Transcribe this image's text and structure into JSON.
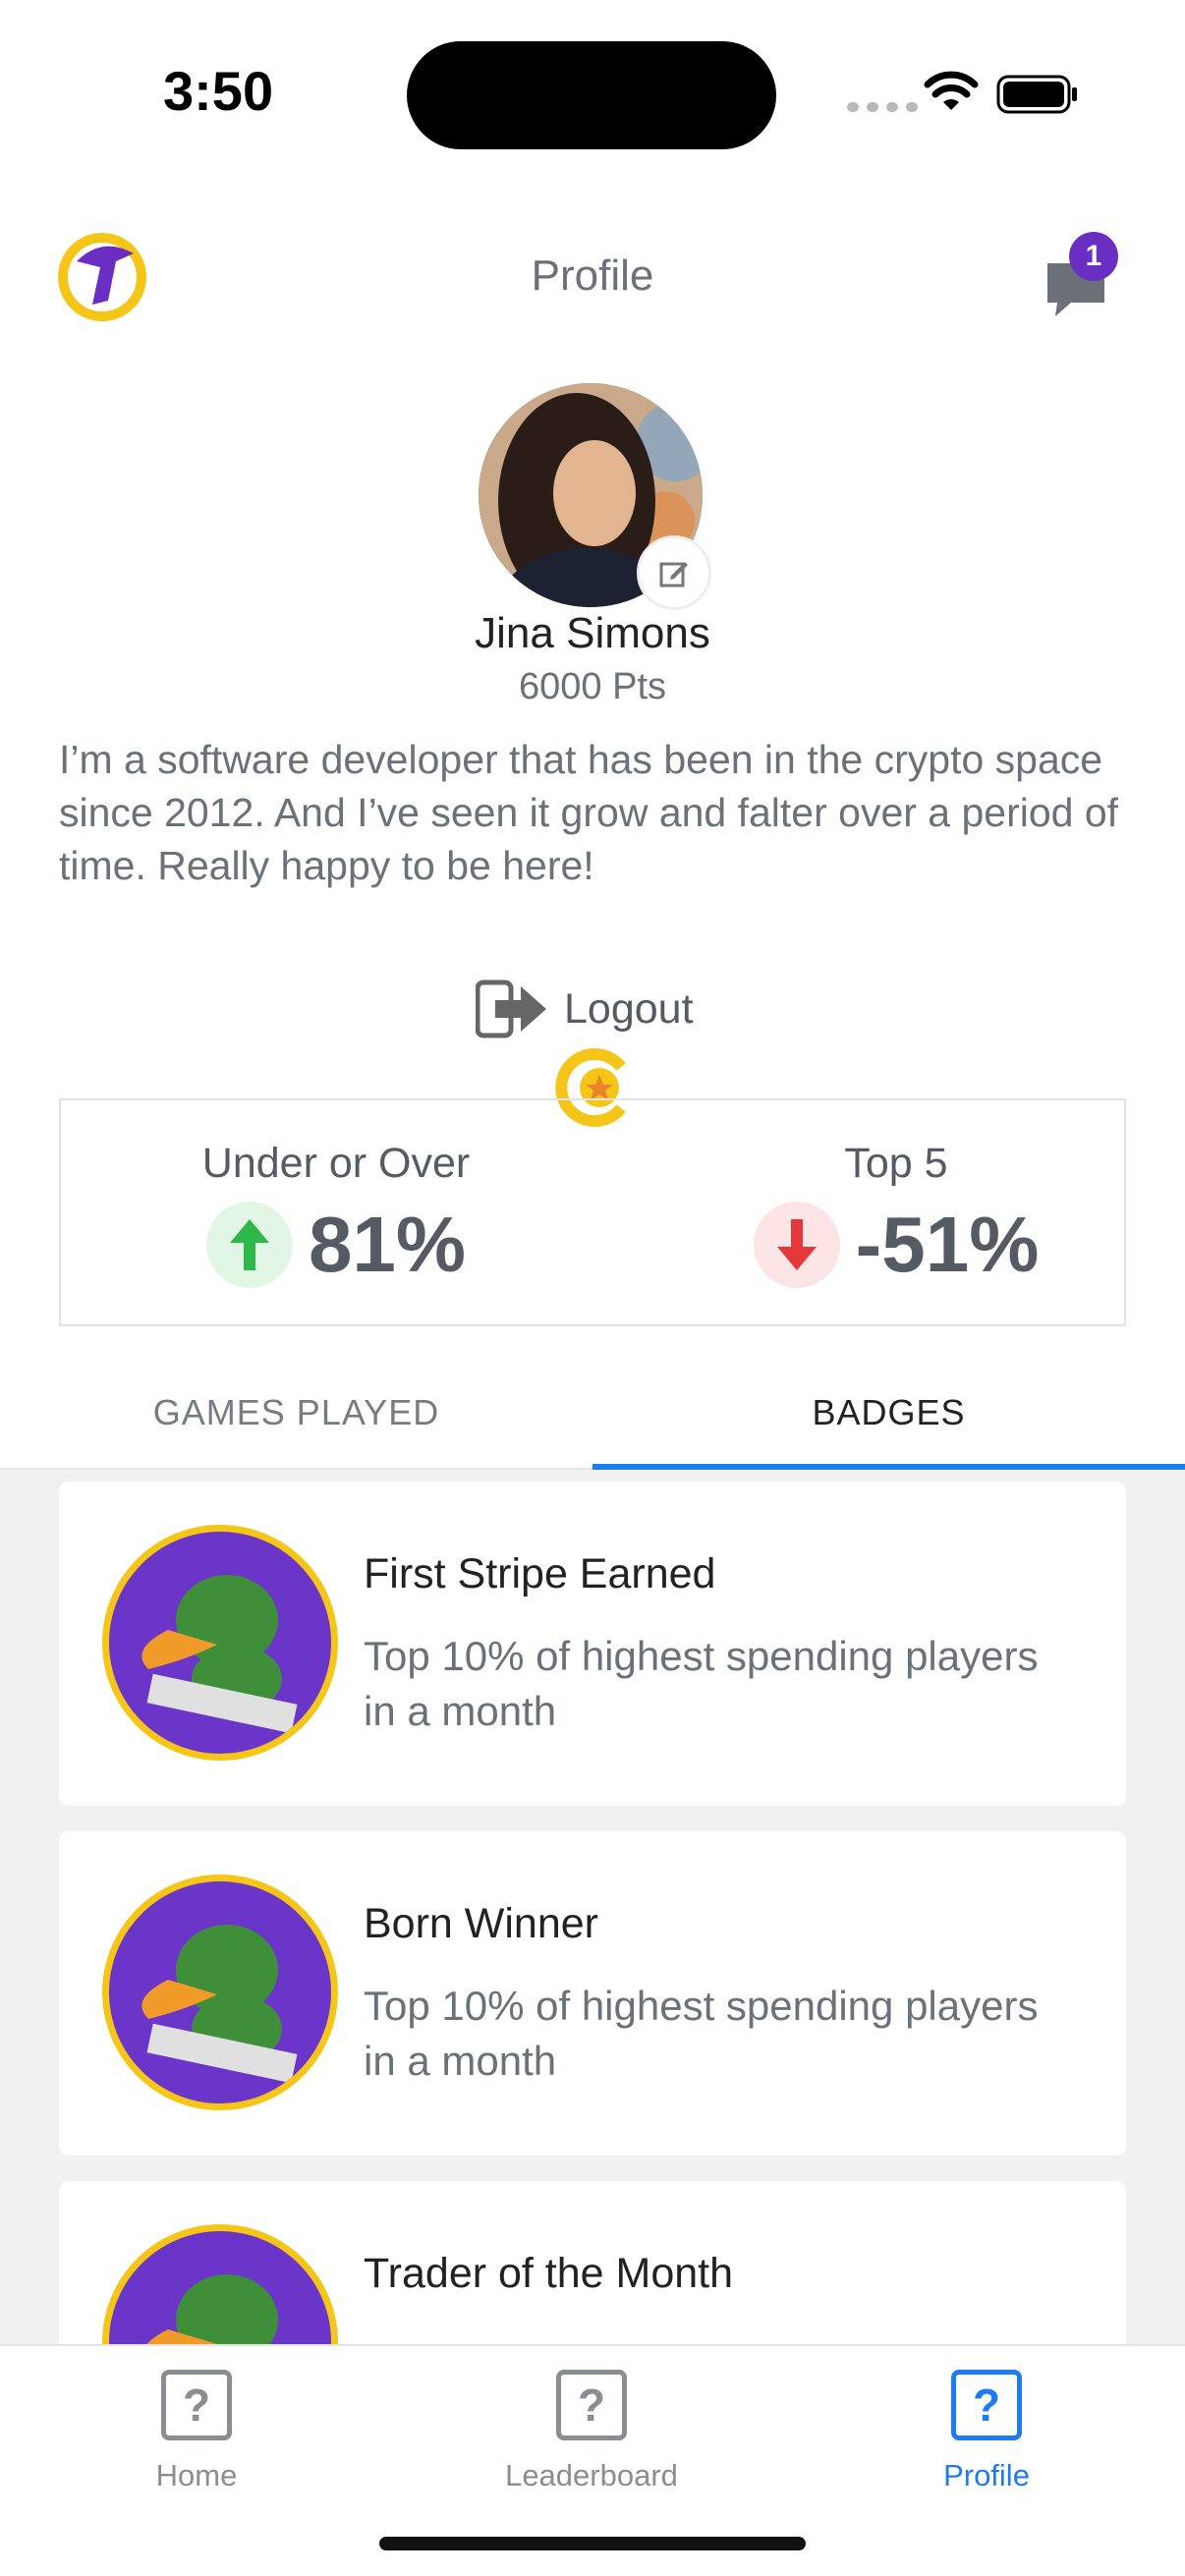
{
  "status_bar": {
    "time": "3:50"
  },
  "header": {
    "title": "Profile",
    "chat_badge_count": "1"
  },
  "profile": {
    "name": "Jina Simons",
    "points": "6000 Pts",
    "bio": "I’m a software developer that has been in the crypto space since 2012. And I’ve seen it grow and falter over a period of time. Really happy to be here!",
    "logout_label": "Logout"
  },
  "stats": {
    "left": {
      "label": "Under or Over",
      "value": "81%",
      "trend": "up"
    },
    "right": {
      "label": "Top 5",
      "value": "-51%",
      "trend": "down"
    }
  },
  "tabs": [
    {
      "label": "GAMES PLAYED",
      "active": false
    },
    {
      "label": "BADGES",
      "active": true
    }
  ],
  "badges": [
    {
      "title": "First Stripe Earned",
      "description": "Top 10% of highest spending players in a month"
    },
    {
      "title": "Born Winner",
      "description": "Top 10% of highest spending players in a month"
    },
    {
      "title": "Trader of the Month",
      "description": ""
    }
  ],
  "nav": [
    {
      "label": "Home",
      "icon": "question-icon",
      "active": false
    },
    {
      "label": "Leaderboard",
      "icon": "question-icon",
      "active": false
    },
    {
      "label": "Profile",
      "icon": "question-icon",
      "active": true
    }
  ],
  "colors": {
    "accent": "#1e7cf0",
    "badge_purple": "#6a2fc2",
    "up_green": "#2fb84a",
    "down_red": "#e5383b",
    "gold": "#f5c518"
  }
}
